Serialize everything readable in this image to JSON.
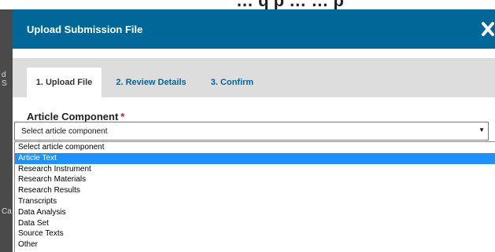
{
  "modal": {
    "title": "Upload Submission File"
  },
  "tabs": [
    {
      "label": "1. Upload File",
      "active": true
    },
    {
      "label": "2. Review Details",
      "active": false
    },
    {
      "label": "3. Confirm",
      "active": false
    }
  ],
  "field": {
    "label": "Article Component",
    "required_marker": "*",
    "select_value": "Select article component"
  },
  "dropdown": {
    "options": [
      "Select article component",
      "Article Text",
      "Research Instrument",
      "Research Materials",
      "Research Results",
      "Transcripts",
      "Data Analysis",
      "Data Set",
      "Source Texts",
      "Other"
    ],
    "highlighted_index": 1
  },
  "colors": {
    "header": "#006798",
    "tab_bar": "#dddddd",
    "tab_link": "#006798",
    "required": "#d00a6c",
    "highlight": "#1e90ff"
  }
}
